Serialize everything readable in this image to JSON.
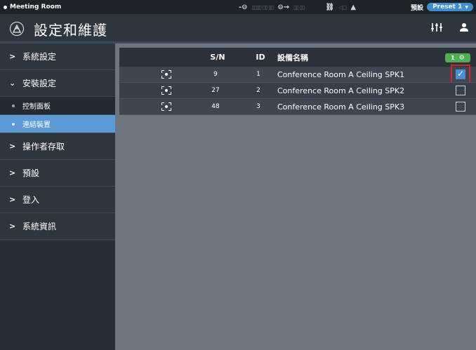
{
  "statusbar": {
    "room_name": "Meeting Room",
    "preset_label": "預設",
    "preset_value": "Preset 1",
    "icons": [
      "input-icon",
      "output-icon",
      "link-icon",
      "mute-icon",
      "warning-icon"
    ]
  },
  "header": {
    "title": "設定和維護",
    "icons": [
      "logo-icon",
      "mixer-icon",
      "user-icon"
    ]
  },
  "sidebar": {
    "items": [
      {
        "label": "系統設定",
        "expanded": false
      },
      {
        "label": "安裝設定",
        "expanded": true,
        "children": [
          {
            "label": "控制面板",
            "active": false
          },
          {
            "label": "連結裝置",
            "active": true
          }
        ]
      },
      {
        "label": "操作者存取",
        "expanded": false
      },
      {
        "label": "預設",
        "expanded": false
      },
      {
        "label": "登入",
        "expanded": false
      },
      {
        "label": "系統資訊",
        "expanded": false
      }
    ]
  },
  "table": {
    "headers": {
      "sn": "S/N",
      "id": "ID",
      "name": "設備名稱"
    },
    "selected_count": "1",
    "rows": [
      {
        "sn": "9",
        "id": "1",
        "name": "Conference Room A Ceiling SPK1",
        "checked": true
      },
      {
        "sn": "27",
        "id": "2",
        "name": "Conference Room A Ceiling SPK2",
        "checked": false
      },
      {
        "sn": "48",
        "id": "3",
        "name": "Conference Room A Ceiling SPK3",
        "checked": false
      }
    ]
  },
  "colors": {
    "accent": "#3a8fd6",
    "active_nav": "#5c9ad6",
    "badge": "#4fae52",
    "highlight": "#d4242c"
  }
}
